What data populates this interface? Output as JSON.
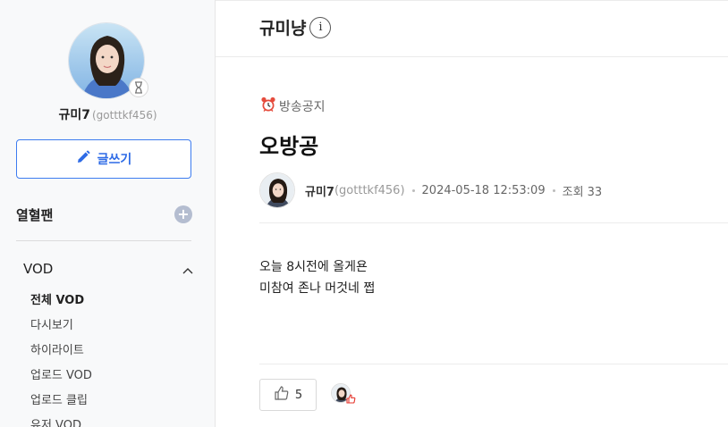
{
  "profile": {
    "name": "규미7",
    "uid": "(gotttkf456)"
  },
  "sidebar": {
    "write_label": "글쓰기",
    "fan_section": "열혈팬",
    "vod_section": "VOD",
    "vod_items": [
      {
        "label": "전체 VOD"
      },
      {
        "label": "다시보기"
      },
      {
        "label": "하이라이트"
      },
      {
        "label": "업로드 VOD"
      },
      {
        "label": "업로드 클립"
      },
      {
        "label": "유저 VOD"
      }
    ]
  },
  "header": {
    "title": "규미냥",
    "info_icon": "i"
  },
  "post": {
    "category": "방송공지",
    "title": "오방공",
    "author_name": "규미7",
    "author_uid": "(gotttkf456)",
    "datetime": "2024-05-18 12:53:09",
    "views": "조회 33",
    "body_lines": [
      "오늘 8시전에 올게욘",
      "미참여 존나 머것네 쩝"
    ],
    "like_count": "5"
  },
  "colors": {
    "accent": "#2e6be6",
    "sidebar_bg": "#f8f9fa"
  }
}
